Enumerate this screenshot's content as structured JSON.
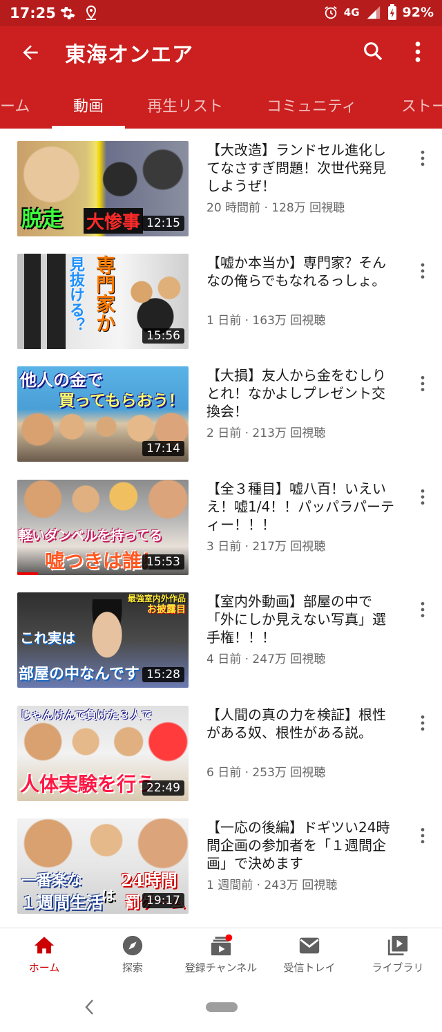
{
  "status": {
    "time": "17:25",
    "network": "4G",
    "battery": "92%"
  },
  "appbar": {
    "title": "東海オンエア"
  },
  "tabs": [
    {
      "label": "ーム"
    },
    {
      "label": "動画"
    },
    {
      "label": "再生リスト"
    },
    {
      "label": "コミュニティ"
    },
    {
      "label": "ストー"
    }
  ],
  "videos": [
    {
      "title": "【大改造】ランドセル進化してなさすぎ問題！次世代発見しようぜ！",
      "meta": "20 時間前 · 128万 回視聴",
      "duration": "12:15",
      "captions": [
        "脱走",
        "大惨事"
      ]
    },
    {
      "title": "【嘘か本当か】専門家？そんなの俺らでもなれるっしょ。",
      "meta": "1 日前 · 163万 回視聴",
      "duration": "15:56",
      "captions": [
        "見抜ける？",
        "専門家か"
      ]
    },
    {
      "title": "【大損】友人から金をむしりとれ！なかよしプレゼント交換会！",
      "meta": "2 日前 · 213万 回視聴",
      "duration": "17:14",
      "captions": [
        "他人の金で",
        "買ってもらおう！"
      ]
    },
    {
      "title": "【全３種目】嘘八百！いえいえ！嘘1/4！！パッパラパーティー！！！",
      "meta": "3 日前 · 217万 回視聴",
      "duration": "15:53",
      "captions": [
        "軽いダンベルを持ってる",
        "嘘つきは誰！"
      ]
    },
    {
      "title": "【室内外動画】部屋の中で「外にしか見えない写真」選手権！！！",
      "meta": "4 日前 · 247万 回視聴",
      "duration": "15:28",
      "captions": [
        "最強室内外作品",
        "お披露目",
        "これ実は",
        "部屋の中なんです"
      ]
    },
    {
      "title": "【人間の真の力を検証】根性がある奴、根性がある説。",
      "meta": "6 日前 · 253万 回視聴",
      "duration": "22:49",
      "captions": [
        "じゃんけんで負けた３人で",
        "人体実験を行う"
      ]
    },
    {
      "title": "【一応の後編】ドギツい24時間企画の参加者を「１週間企画」で決めます",
      "meta": "1 週間前 · 243万 回視聴",
      "duration": "19:17",
      "captions": [
        "一番楽な",
        "１週間生活",
        "は",
        "24時間",
        "罰ゲーム"
      ]
    }
  ],
  "bottomnav": [
    {
      "label": "ホーム",
      "icon": "home-icon"
    },
    {
      "label": "探索",
      "icon": "explore-icon"
    },
    {
      "label": "登録チャンネル",
      "icon": "subscriptions-icon"
    },
    {
      "label": "受信トレイ",
      "icon": "inbox-icon"
    },
    {
      "label": "ライブラリ",
      "icon": "library-icon"
    }
  ],
  "colors": {
    "brand_red": "#cc1f1f",
    "status_red": "#b71c1c",
    "accent_red": "#cc0000"
  }
}
